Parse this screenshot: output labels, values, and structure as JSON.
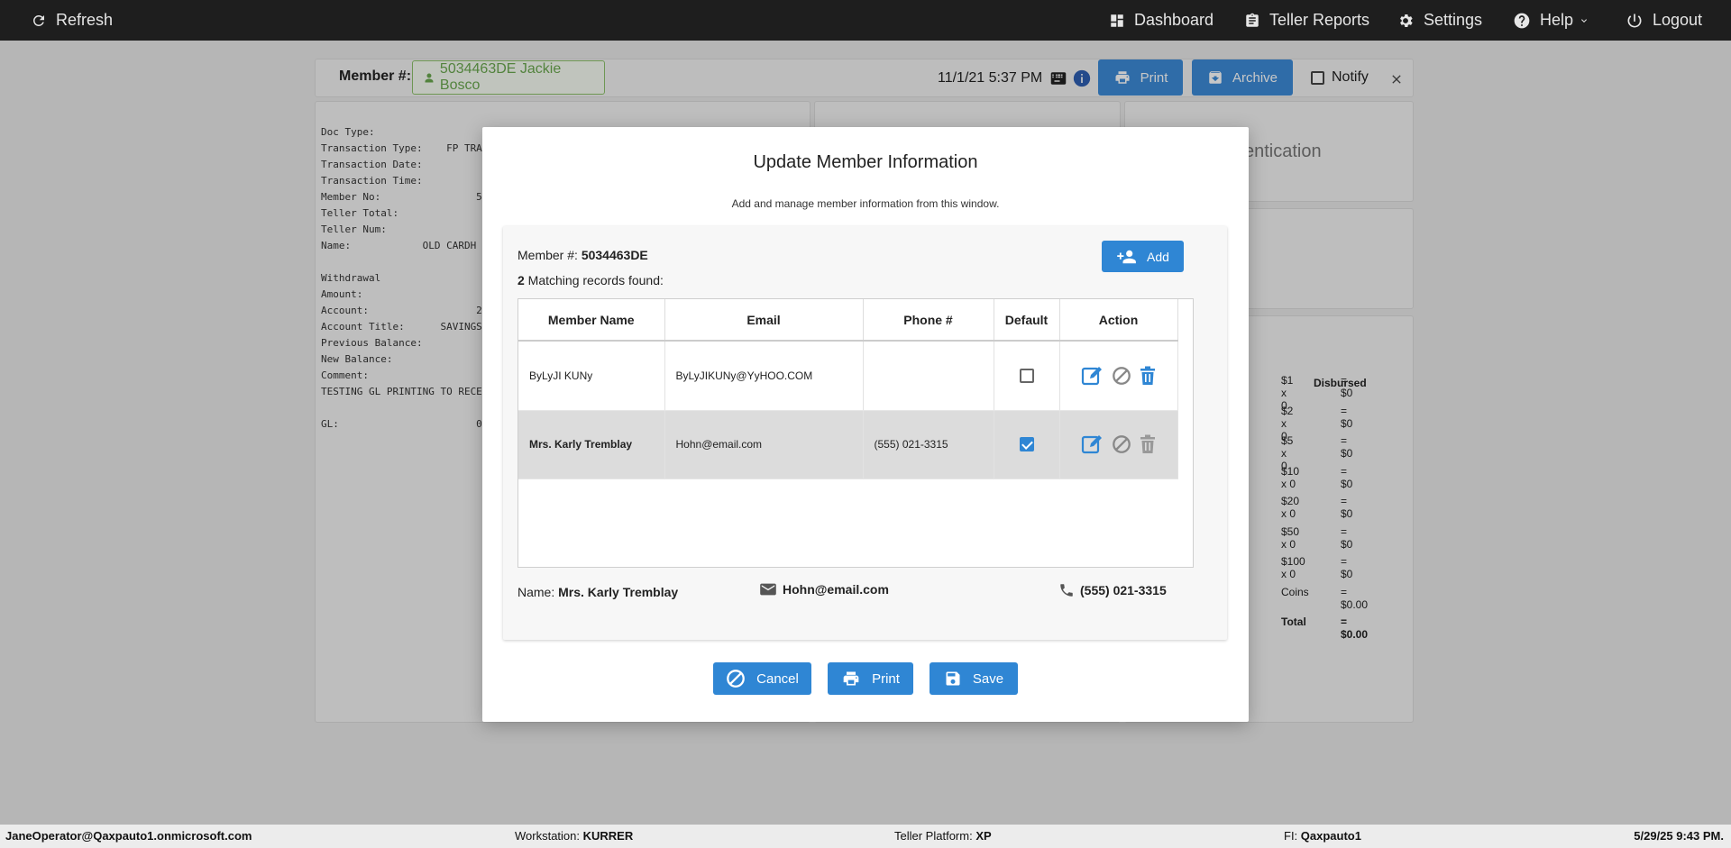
{
  "topbar": {
    "refresh": "Refresh",
    "dashboard": "Dashboard",
    "teller_reports": "Teller Reports",
    "settings": "Settings",
    "help": "Help",
    "logout": "Logout"
  },
  "member_bar": {
    "label": "Member #:",
    "member": "5034463DE Jackie Bosco",
    "datetime": "11/1/21 5:37 PM",
    "print": "Print",
    "archive": "Archive",
    "notify": "Notify"
  },
  "receipt": {
    "lines": "Doc Type:\nTransaction Type:    FP TRA\nTransaction Date:\nTransaction Time:\nMember No:                5\nTeller Total:\nTeller Num:\nName:            OLD CARDH\n\nWithdrawal\nAmount:\nAccount:                  2\nAccount Title:      SAVINGS\nPrevious Balance:\nNew Balance:\nComment:\nTESTING GL PRINTING TO RECE\n\nGL:                       0"
  },
  "background_right": {
    "authentication_fragment": "entication",
    "disbursed_header": "Disbursed",
    "denominations": [
      {
        "label": "$1 x 0",
        "value": "= $0"
      },
      {
        "label": "$2 x 0",
        "value": "= $0"
      },
      {
        "label": "$5 x 0",
        "value": "= $0"
      },
      {
        "label": "$10 x 0",
        "value": "= $0"
      },
      {
        "label": "$20 x 0",
        "value": "= $0"
      },
      {
        "label": "$50 x 0",
        "value": "= $0"
      },
      {
        "label": "$100 x 0",
        "value": "= $0"
      },
      {
        "label": "Coins",
        "value": "= $0.00"
      },
      {
        "label": "Total",
        "value": "= $0.00"
      }
    ]
  },
  "modal": {
    "title": "Update Member Information",
    "subtitle": "Add and manage member information from this window.",
    "member_label": "Member #: ",
    "member_number": "5034463DE",
    "match_count": "2",
    "match_text": " Matching records found:",
    "add_button": "Add",
    "columns": [
      "Member Name",
      "Email",
      "Phone #",
      "Default",
      "Action"
    ],
    "rows": [
      {
        "name": "ByLyJI KUNy",
        "email": "ByLyJIKUNy@YyHOO.COM",
        "phone": "",
        "default": false
      },
      {
        "name": "Mrs. Karly Tremblay",
        "email": "Hohn@email.com",
        "phone": "(555) 021-3315",
        "default": true
      }
    ],
    "summary": {
      "name_label": "Name: ",
      "name": "Mrs. Karly Tremblay",
      "email": "Hohn@email.com",
      "phone": "(555) 021-3315"
    },
    "cancel_button": "Cancel",
    "print_button": "Print",
    "save_button": "Save"
  },
  "statusbar": {
    "user": "JaneOperator@Qaxpauto1.onmicrosoft.com",
    "workstation_label": "Workstation: ",
    "workstation": "KURRER",
    "platform_label": "Teller Platform: ",
    "platform": "XP",
    "fi_label": "FI: ",
    "fi": "Qaxpauto1",
    "datetime": "5/29/25 9:43 PM."
  },
  "colors": {
    "primary": "#2f86d4",
    "topbar": "#1e1e1e",
    "member_green": "#6aa84f"
  }
}
